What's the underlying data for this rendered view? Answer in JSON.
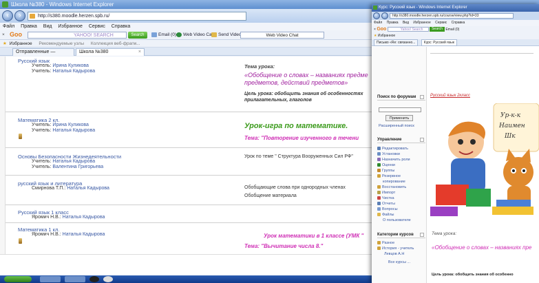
{
  "window": {
    "title": "Школа №380 - Windows Internet Explorer",
    "url": "http://s380.moodle.herzen.spb.ru/"
  },
  "menu": [
    "Файл",
    "Правка",
    "Вид",
    "Избранное",
    "Сервис",
    "Справка"
  ],
  "toolbar": {
    "close": "×",
    "logo": "Goo",
    "yahoo_placeholder": "YAHOO! SEARCH",
    "search_btn": "Search",
    "email": "Email (0)",
    "video_call": "Web Video Call",
    "send_video": "Send Video",
    "video_chat": "Web Video Chat"
  },
  "favbar": {
    "favorites": "Избранное",
    "recommended": "Рекомендуемые узлы",
    "gallery": "Коллекция веб-фрагм..."
  },
  "tabs": [
    {
      "label": "Отправленные — Яндекс..."
    },
    {
      "label": "Школа №380"
    }
  ],
  "courses": [
    {
      "name": "Русский язык",
      "teachers": [
        {
          "role": "Учитель:",
          "name": "Ирина Куликова"
        },
        {
          "role": "Учитель:",
          "name": "Наталья Кадырова"
        }
      ],
      "desc1": "Тема урока:",
      "desc2": "«Обобщение о словах – названиях предме",
      "desc3": "предметов, действий предметов»",
      "desc4": "Цель урока: обобщить знания об особенностях",
      "desc5": "прилагательных, глаголов"
    },
    {
      "name": "Математика 2 кл.",
      "teachers": [
        {
          "role": "Учитель:",
          "name": "Ирина Куликова"
        },
        {
          "role": "Учитель:",
          "name": "Наталья Кадырова"
        }
      ],
      "desc1": "Урок-игра по математике.",
      "desc2": "Тема: \"Повторение изученного в течени"
    },
    {
      "name": "Основы Безопасности Жизнедеятельности",
      "teachers": [
        {
          "role": "Учитель:",
          "name": "Наталья Кадырова"
        },
        {
          "role": "Учитель:",
          "name": "Валентина Григорьева"
        }
      ],
      "desc1": "Урок по теме \" Структура Вооруженных Сил РФ\""
    },
    {
      "name": "русский язык и литература",
      "teachers": [
        {
          "role": "Смирнова Т.П.:",
          "name": "Наталья Кадырова"
        }
      ],
      "desc1": "Обобщающие слова при однородных членах",
      "desc2": "Обобщение материала"
    },
    {
      "name": "Русский язык 1 класс",
      "teachers": [
        {
          "role": "Яромич Н.В.:",
          "name": "Наталья Кадырова"
        }
      ]
    },
    {
      "name": "Математика 1 кл.",
      "teachers": [
        {
          "role": "Яромич Н.В.:",
          "name": "Наталья Кадырова"
        }
      ],
      "desc1": "Урок математики в 1 классе (УМК \"",
      "desc2": "Тема: \"Вычитание числа 8.\""
    }
  ],
  "win2": {
    "title": "Курс: Русский язык - Windows Internet Explorer",
    "url": "http://s380.moodle.herzen.spb.ru/course/view.php?id=33",
    "menu": [
      "Файл",
      "Правка",
      "Вид",
      "Избранное",
      "Сервис",
      "Справка"
    ],
    "yahoo": "Yahoo! Search",
    "fav": "Избранное",
    "tabs": [
      "Письмо «Re: связанно...",
      "Курс: Русский язык"
    ],
    "forum_search": "Поиск по форумам",
    "apply": "Применить",
    "advanced": "Расширенный поиск",
    "manage": "Управление",
    "manage_items": [
      "Редактировать",
      "Установки",
      "Назначить роли",
      "Оценки",
      "Группы",
      "Резервное",
      "копирование",
      "Восстановить",
      "Импорт",
      "Чистка",
      "Отчеты",
      "Вопросы",
      "Файлы",
      "О пользователе"
    ],
    "categories": "Категории курсов",
    "cat_items": [
      "Разное",
      "История - учитель",
      "Левцов А.Н",
      "Все курсы ..."
    ],
    "course_link": "Русский язык 2класс",
    "theme": "Тема урока:",
    "topic": "«Обобщение о словах – названиях пре",
    "goal": "Цель урока: обобщить знания об особенно"
  },
  "colors": {
    "link": "#3757a3",
    "purple": "#a0209e",
    "green": "#3a9a1a",
    "magenta": "#cf2fb5"
  }
}
